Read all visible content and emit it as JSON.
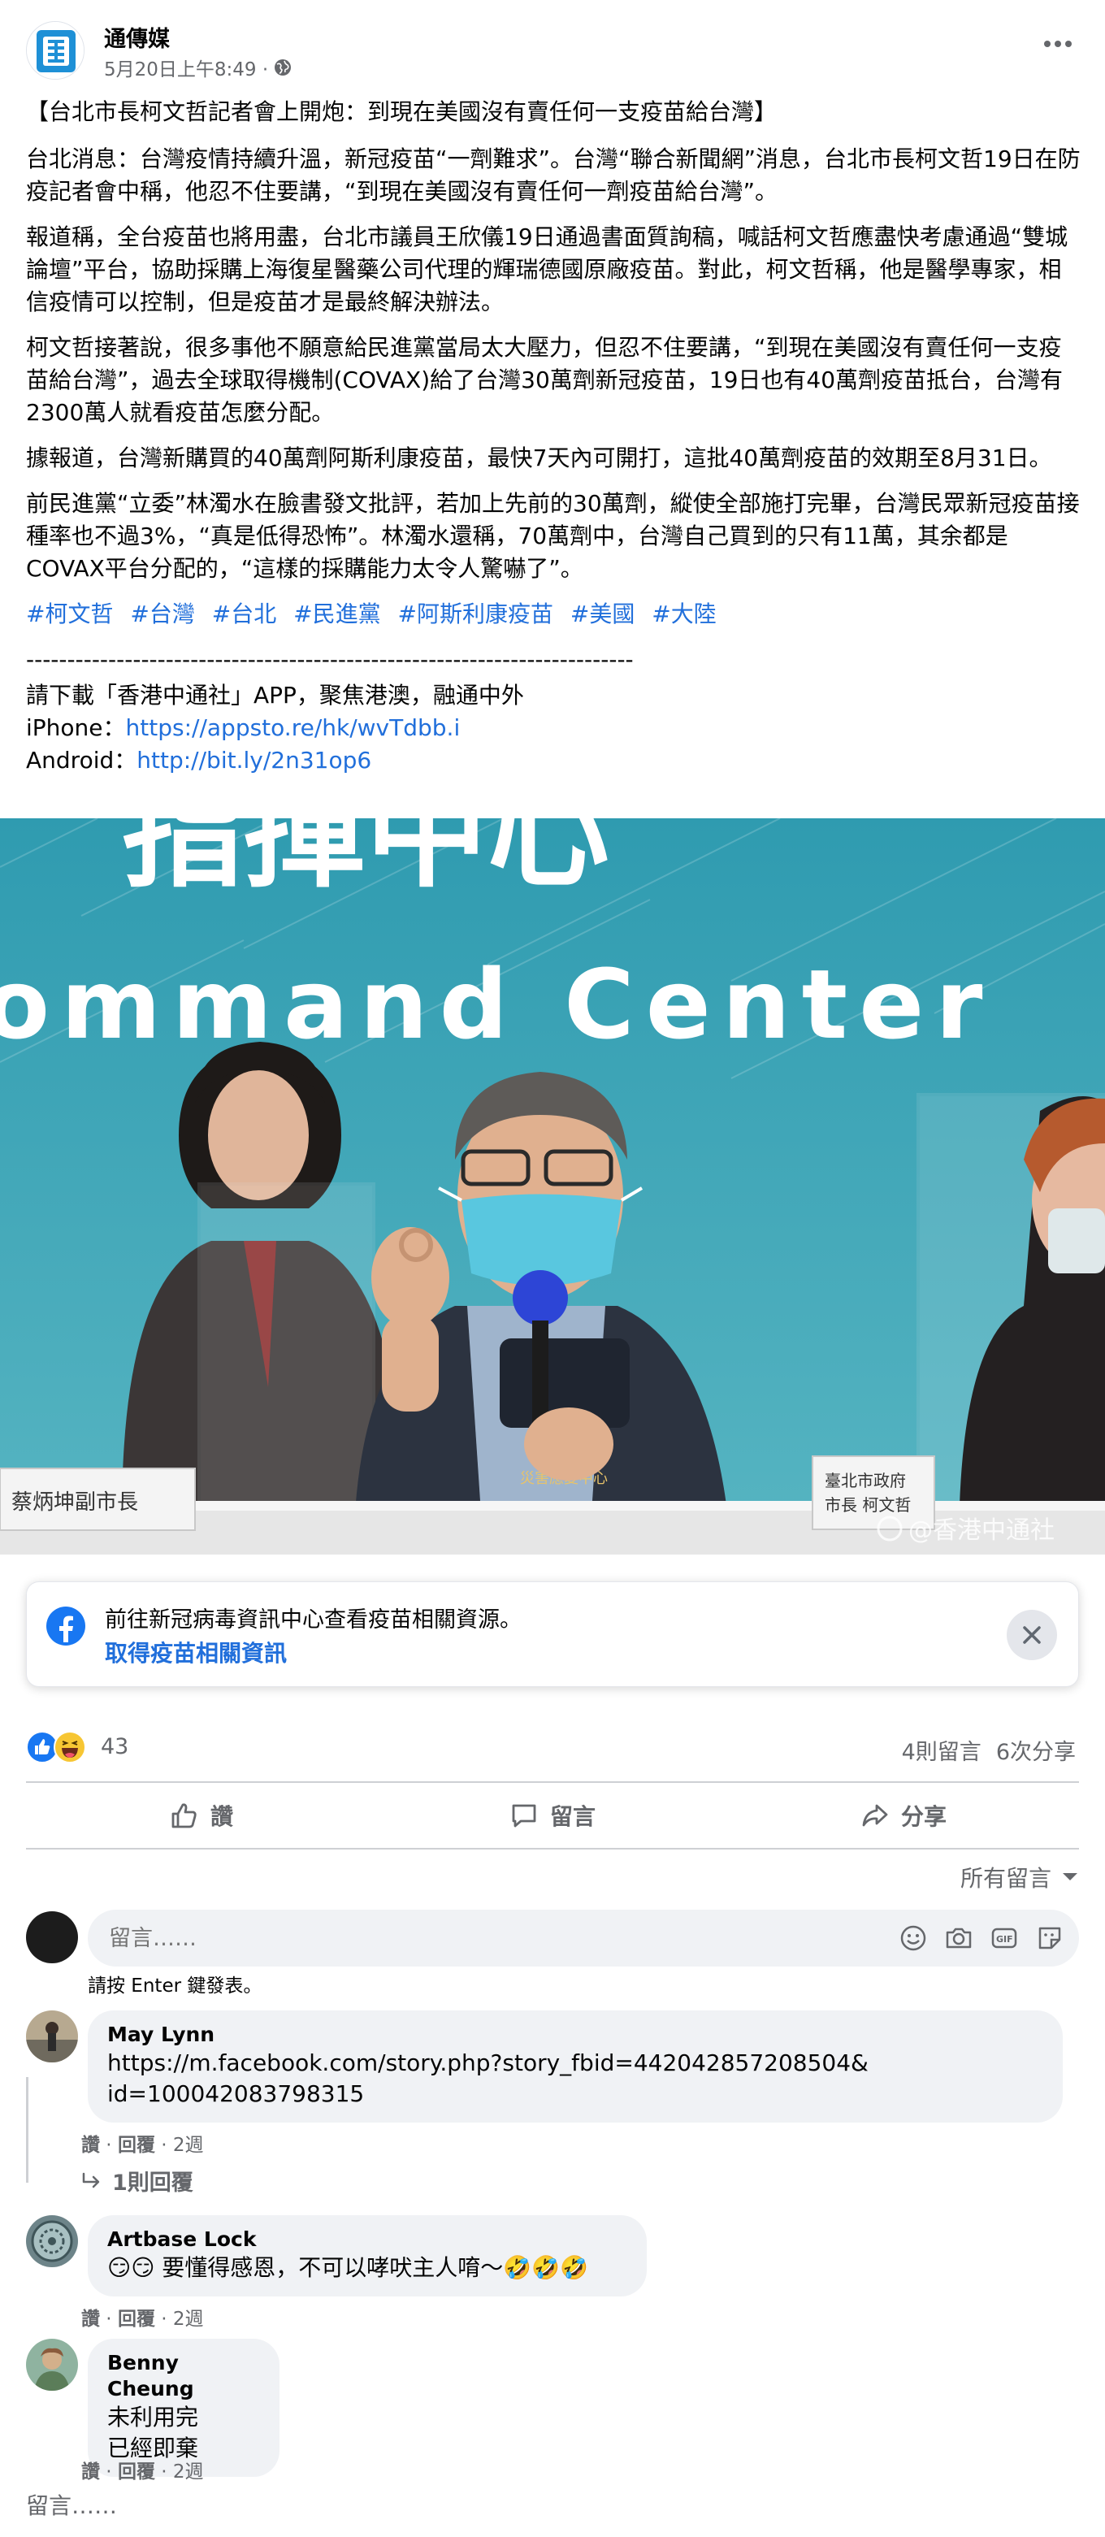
{
  "post": {
    "page_name": "通傳媒",
    "meta": "5月20日上午8:49 ·",
    "headline": "【台北市長柯文哲記者會上開炮：到現在美國沒有賣任何一支疫苗給台灣】",
    "paragraphs": [
      "台北消息：台灣疫情持續升溫，新冠疫苗“一劑難求”。台灣“聯合新聞網”消息，台北市長柯文哲19日在防疫記者會中稱，他忍不住要講，“到現在美國沒有賣任何一劑疫苗給台灣”。",
      "報道稱，全台疫苗也將用盡，台北市議員王欣儀19日通過書面質詢稿，喊話柯文哲應盡快考慮通過“雙城論壇”平台，協助採購上海復星醫藥公司代理的輝瑞德國原廠疫苗。對此，柯文哲稱，他是醫學專家，相信疫情可以控制，但是疫苗才是最終解決辦法。",
      "柯文哲接著說，很多事他不願意給民進黨當局太大壓力，但忍不住要講，“到現在美國沒有賣任何一支疫苗給台灣”，過去全球取得機制(COVAX)給了台灣30萬劑新冠疫苗，19日也有40萬劑疫苗抵台，台灣有2300萬人就看疫苗怎麼分配。",
      "據報道，台灣新購買的40萬劑阿斯利康疫苗，最快7天內可開打，這批40萬劑疫苗的效期至8月31日。",
      "前民進黨“立委”林濁水在臉書發文批評，若加上先前的30萬劑，縱使全部施打完畢，台灣民眾新冠疫苗接種率也不過3%，“真是低得恐怖”。林濁水還稱，70萬劑中，台灣自己買到的只有11萬，其余都是COVAX平台分配的，“這樣的採購能力太令人驚嚇了”。"
    ],
    "hashtags": [
      "#柯文哲",
      "#台灣",
      "#台北",
      "#民進黨",
      "#阿斯利康疫苗",
      "#美國",
      "#大陸"
    ],
    "divider": "--------------------------------------------------------------------------",
    "download_line": "請下載「香港中通社」APP，聚焦港澳，融通中外",
    "iphone_label": "iPhone：",
    "iphone_link": "https://appsto.re/hk/wvTdbb.i",
    "android_label": "Android：",
    "android_link": "http://bit.ly/2n31op6"
  },
  "photo": {
    "banner_text_top": "指揮中心",
    "banner_text": "ommand Center",
    "nameplate_left": "蔡炳坤副市長",
    "nameplate_right_line1": "臺北市政府",
    "nameplate_right_line2": "市長 柯文哲",
    "vest_text": "災害應變中心",
    "watermark": "@香港中通社"
  },
  "info_card": {
    "text": "前往新冠病毒資訊中心查看疫苗相關資源。",
    "link": "取得疫苗相關資訊"
  },
  "reactions": {
    "count": "43",
    "comments": "4則留言",
    "shares": "6次分享"
  },
  "actions": {
    "like": "讚",
    "comment": "留言",
    "share": "分享"
  },
  "comments_section": {
    "sort_label": "所有留言",
    "input_placeholder": "留言……",
    "enter_hint": "請按 Enter 鍵發表。",
    "items": [
      {
        "author": "May Lynn",
        "text_line1": "https://m.facebook.com/story.php?story_fbid=442042857208504&",
        "text_line2": "id=100042083798315",
        "like": "讚",
        "reply": "回覆",
        "time": "2週",
        "replies": "1則回覆"
      },
      {
        "author": "Artbase Lock",
        "text": "😏😏 要懂得感恩，不可以哮吠主人唷～🤣🤣🤣",
        "like": "讚",
        "reply": "回覆",
        "time": "2週"
      },
      {
        "author": "Benny Cheung",
        "text_line1": "未利用完",
        "text_line2": "已經即棄",
        "like": "讚",
        "reply": "回覆",
        "time": "2週"
      }
    ],
    "footer_label": "留言……"
  },
  "colors": {
    "link_blue": "#216fdb",
    "secondary_text": "#65676b",
    "bubble_bg": "#f0f2f5",
    "facebook_blue": "#1877f2"
  },
  "icons": [
    "globe-icon",
    "more-icon",
    "facebook-icon",
    "close-icon",
    "like-reaction-icon",
    "haha-reaction-icon",
    "like-icon",
    "comment-icon",
    "share-icon",
    "chevron-down-icon",
    "emoji-icon",
    "camera-icon",
    "gif-icon",
    "sticker-icon",
    "reply-arrow-icon"
  ]
}
